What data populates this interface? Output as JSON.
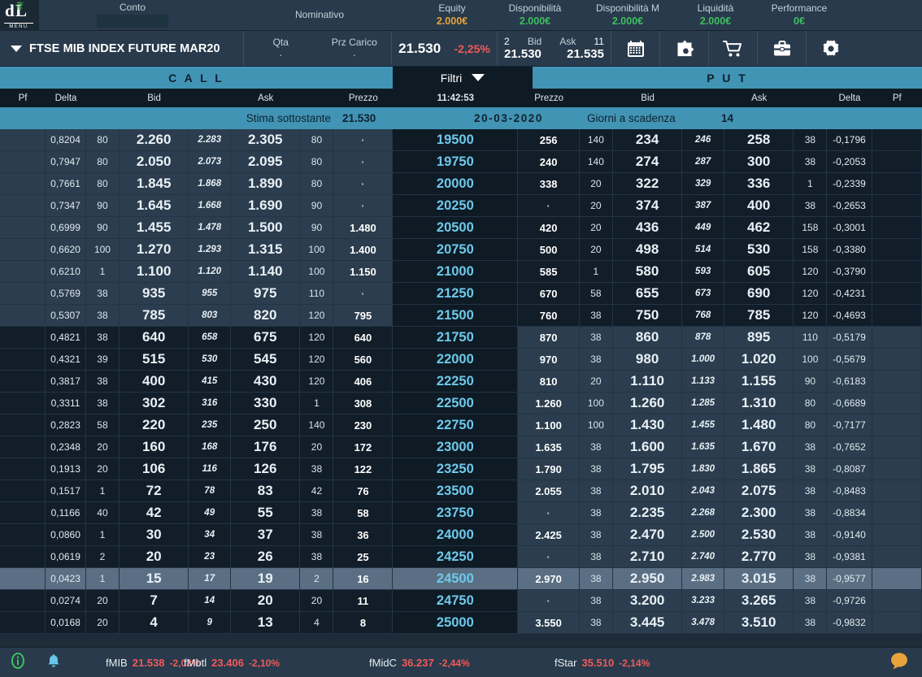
{
  "header": {
    "logo": {
      "d": "d",
      "l": "L",
      "ite": "ite",
      "menu": "MENU"
    },
    "fields": [
      {
        "label": "Conto",
        "value": "",
        "color": ""
      },
      {
        "label": "Nominativo",
        "value": "",
        "color": ""
      },
      {
        "label": "Equity",
        "value": "2.000€",
        "color": "#e8a33d"
      },
      {
        "label": "Disponibilità",
        "value": "2.000€",
        "color": "#3fbf5f"
      },
      {
        "label": "Disponibilità M",
        "value": "2.000€",
        "color": "#3fbf5f"
      },
      {
        "label": "Liquidità",
        "value": "2.000€",
        "color": "#3fbf5f"
      },
      {
        "label": "Performance",
        "value": "0€",
        "color": "#3fbf5f"
      }
    ]
  },
  "instrument": {
    "name": "FTSE MIB INDEX FUTURE MAR20",
    "qta_label": "Qta",
    "qta_value": "·",
    "prz_carico_label": "Prz Carico",
    "prz_carico_value": "·",
    "last_price": "21.530",
    "change_pct": "-2,25%",
    "bid_qty": "2",
    "bid_label": "Bid",
    "ask_label": "Ask",
    "ask_qty": "11",
    "bid_price": "21.530",
    "ask_price": "21.535",
    "tools": [
      "calendar-icon",
      "puzzle-icon",
      "cart-icon",
      "briefcase-icon",
      "gear-icon"
    ]
  },
  "banner": {
    "call": "C A L L",
    "filters": "Filtri",
    "put": "P U T"
  },
  "columns": {
    "call": [
      "Pf",
      "Delta",
      "",
      "Bid",
      "",
      "Ask",
      "",
      "Prezzo"
    ],
    "time": "11:42:53",
    "put": [
      "Prezzo",
      "",
      "Bid",
      "",
      "Ask",
      "",
      "Delta",
      "Pf"
    ]
  },
  "info": {
    "stima_label": "Stima sottostante",
    "stima_value": "21.530",
    "expiry": "20-03-2020",
    "giorni_label": "Giorni a scadenza",
    "giorni_value": "14"
  },
  "chain": [
    {
      "strike": "19500",
      "sel": false,
      "call_itm": true,
      "put_itm": false,
      "c_delta": "0,8204",
      "c_bq": "80",
      "c_bid": "2.260",
      "c_mid": "2.283",
      "c_ask": "2.305",
      "c_aq": "80",
      "c_prz": "·",
      "p_prz": "256",
      "p_bq": "140",
      "p_bid": "234",
      "p_mid": "246",
      "p_ask": "258",
      "p_aq": "38",
      "p_delta": "-0,1796"
    },
    {
      "strike": "19750",
      "sel": false,
      "call_itm": true,
      "put_itm": false,
      "c_delta": "0,7947",
      "c_bq": "80",
      "c_bid": "2.050",
      "c_mid": "2.073",
      "c_ask": "2.095",
      "c_aq": "80",
      "c_prz": "·",
      "p_prz": "240",
      "p_bq": "140",
      "p_bid": "274",
      "p_mid": "287",
      "p_ask": "300",
      "p_aq": "38",
      "p_delta": "-0,2053"
    },
    {
      "strike": "20000",
      "sel": false,
      "call_itm": true,
      "put_itm": false,
      "c_delta": "0,7661",
      "c_bq": "80",
      "c_bid": "1.845",
      "c_mid": "1.868",
      "c_ask": "1.890",
      "c_aq": "80",
      "c_prz": "·",
      "p_prz": "338",
      "p_bq": "20",
      "p_bid": "322",
      "p_mid": "329",
      "p_ask": "336",
      "p_aq": "1",
      "p_delta": "-0,2339"
    },
    {
      "strike": "20250",
      "sel": false,
      "call_itm": true,
      "put_itm": false,
      "c_delta": "0,7347",
      "c_bq": "90",
      "c_bid": "1.645",
      "c_mid": "1.668",
      "c_ask": "1.690",
      "c_aq": "90",
      "c_prz": "·",
      "p_prz": "·",
      "p_bq": "20",
      "p_bid": "374",
      "p_mid": "387",
      "p_ask": "400",
      "p_aq": "38",
      "p_delta": "-0,2653"
    },
    {
      "strike": "20500",
      "sel": false,
      "call_itm": true,
      "put_itm": false,
      "c_delta": "0,6999",
      "c_bq": "90",
      "c_bid": "1.455",
      "c_mid": "1.478",
      "c_ask": "1.500",
      "c_aq": "90",
      "c_prz": "1.480",
      "p_prz": "420",
      "p_bq": "20",
      "p_bid": "436",
      "p_mid": "449",
      "p_ask": "462",
      "p_aq": "158",
      "p_delta": "-0,3001"
    },
    {
      "strike": "20750",
      "sel": false,
      "call_itm": true,
      "put_itm": false,
      "c_delta": "0,6620",
      "c_bq": "100",
      "c_bid": "1.270",
      "c_mid": "1.293",
      "c_ask": "1.315",
      "c_aq": "100",
      "c_prz": "1.400",
      "p_prz": "500",
      "p_bq": "20",
      "p_bid": "498",
      "p_mid": "514",
      "p_ask": "530",
      "p_aq": "158",
      "p_delta": "-0,3380"
    },
    {
      "strike": "21000",
      "sel": false,
      "call_itm": true,
      "put_itm": false,
      "c_delta": "0,6210",
      "c_bq": "1",
      "c_bid": "1.100",
      "c_mid": "1.120",
      "c_ask": "1.140",
      "c_aq": "100",
      "c_prz": "1.150",
      "p_prz": "585",
      "p_bq": "1",
      "p_bid": "580",
      "p_mid": "593",
      "p_ask": "605",
      "p_aq": "120",
      "p_delta": "-0,3790"
    },
    {
      "strike": "21250",
      "sel": false,
      "call_itm": true,
      "put_itm": false,
      "c_delta": "0,5769",
      "c_bq": "38",
      "c_bid": "935",
      "c_mid": "955",
      "c_ask": "975",
      "c_aq": "110",
      "c_prz": "·",
      "p_prz": "670",
      "p_bq": "58",
      "p_bid": "655",
      "p_mid": "673",
      "p_ask": "690",
      "p_aq": "120",
      "p_delta": "-0,4231"
    },
    {
      "strike": "21500",
      "sel": false,
      "call_itm": true,
      "put_itm": false,
      "c_delta": "0,5307",
      "c_bq": "38",
      "c_bid": "785",
      "c_mid": "803",
      "c_ask": "820",
      "c_aq": "120",
      "c_prz": "795",
      "p_prz": "760",
      "p_bq": "38",
      "p_bid": "750",
      "p_mid": "768",
      "p_ask": "785",
      "p_aq": "120",
      "p_delta": "-0,4693"
    },
    {
      "strike": "21750",
      "sel": false,
      "call_itm": false,
      "put_itm": true,
      "c_delta": "0,4821",
      "c_bq": "38",
      "c_bid": "640",
      "c_mid": "658",
      "c_ask": "675",
      "c_aq": "120",
      "c_prz": "640",
      "p_prz": "870",
      "p_bq": "38",
      "p_bid": "860",
      "p_mid": "878",
      "p_ask": "895",
      "p_aq": "110",
      "p_delta": "-0,5179"
    },
    {
      "strike": "22000",
      "sel": false,
      "call_itm": false,
      "put_itm": true,
      "c_delta": "0,4321",
      "c_bq": "39",
      "c_bid": "515",
      "c_mid": "530",
      "c_ask": "545",
      "c_aq": "120",
      "c_prz": "560",
      "p_prz": "970",
      "p_bq": "38",
      "p_bid": "980",
      "p_mid": "1.000",
      "p_ask": "1.020",
      "p_aq": "100",
      "p_delta": "-0,5679"
    },
    {
      "strike": "22250",
      "sel": false,
      "call_itm": false,
      "put_itm": true,
      "c_delta": "0,3817",
      "c_bq": "38",
      "c_bid": "400",
      "c_mid": "415",
      "c_ask": "430",
      "c_aq": "120",
      "c_prz": "406",
      "p_prz": "810",
      "p_bq": "20",
      "p_bid": "1.110",
      "p_mid": "1.133",
      "p_ask": "1.155",
      "p_aq": "90",
      "p_delta": "-0,6183"
    },
    {
      "strike": "22500",
      "sel": false,
      "call_itm": false,
      "put_itm": true,
      "c_delta": "0,3311",
      "c_bq": "38",
      "c_bid": "302",
      "c_mid": "316",
      "c_ask": "330",
      "c_aq": "1",
      "c_prz": "308",
      "p_prz": "1.260",
      "p_bq": "100",
      "p_bid": "1.260",
      "p_mid": "1.285",
      "p_ask": "1.310",
      "p_aq": "80",
      "p_delta": "-0,6689"
    },
    {
      "strike": "22750",
      "sel": false,
      "call_itm": false,
      "put_itm": true,
      "c_delta": "0,2823",
      "c_bq": "58",
      "c_bid": "220",
      "c_mid": "235",
      "c_ask": "250",
      "c_aq": "140",
      "c_prz": "230",
      "p_prz": "1.100",
      "p_bq": "100",
      "p_bid": "1.430",
      "p_mid": "1.455",
      "p_ask": "1.480",
      "p_aq": "80",
      "p_delta": "-0,7177"
    },
    {
      "strike": "23000",
      "sel": false,
      "call_itm": false,
      "put_itm": true,
      "c_delta": "0,2348",
      "c_bq": "20",
      "c_bid": "160",
      "c_mid": "168",
      "c_ask": "176",
      "c_aq": "20",
      "c_prz": "172",
      "p_prz": "1.635",
      "p_bq": "38",
      "p_bid": "1.600",
      "p_mid": "1.635",
      "p_ask": "1.670",
      "p_aq": "38",
      "p_delta": "-0,7652"
    },
    {
      "strike": "23250",
      "sel": false,
      "call_itm": false,
      "put_itm": true,
      "c_delta": "0,1913",
      "c_bq": "20",
      "c_bid": "106",
      "c_mid": "116",
      "c_ask": "126",
      "c_aq": "38",
      "c_prz": "122",
      "p_prz": "1.790",
      "p_bq": "38",
      "p_bid": "1.795",
      "p_mid": "1.830",
      "p_ask": "1.865",
      "p_aq": "38",
      "p_delta": "-0,8087"
    },
    {
      "strike": "23500",
      "sel": false,
      "call_itm": false,
      "put_itm": true,
      "c_delta": "0,1517",
      "c_bq": "1",
      "c_bid": "72",
      "c_mid": "78",
      "c_ask": "83",
      "c_aq": "42",
      "c_prz": "76",
      "p_prz": "2.055",
      "p_bq": "38",
      "p_bid": "2.010",
      "p_mid": "2.043",
      "p_ask": "2.075",
      "p_aq": "38",
      "p_delta": "-0,8483"
    },
    {
      "strike": "23750",
      "sel": false,
      "call_itm": false,
      "put_itm": true,
      "c_delta": "0,1166",
      "c_bq": "40",
      "c_bid": "42",
      "c_mid": "49",
      "c_ask": "55",
      "c_aq": "38",
      "c_prz": "58",
      "p_prz": "·",
      "p_bq": "38",
      "p_bid": "2.235",
      "p_mid": "2.268",
      "p_ask": "2.300",
      "p_aq": "38",
      "p_delta": "-0,8834"
    },
    {
      "strike": "24000",
      "sel": false,
      "call_itm": false,
      "put_itm": true,
      "c_delta": "0,0860",
      "c_bq": "1",
      "c_bid": "30",
      "c_mid": "34",
      "c_ask": "37",
      "c_aq": "38",
      "c_prz": "36",
      "p_prz": "2.425",
      "p_bq": "38",
      "p_bid": "2.470",
      "p_mid": "2.500",
      "p_ask": "2.530",
      "p_aq": "38",
      "p_delta": "-0,9140"
    },
    {
      "strike": "24250",
      "sel": false,
      "call_itm": false,
      "put_itm": true,
      "c_delta": "0,0619",
      "c_bq": "2",
      "c_bid": "20",
      "c_mid": "23",
      "c_ask": "26",
      "c_aq": "38",
      "c_prz": "25",
      "p_prz": "·",
      "p_bq": "38",
      "p_bid": "2.710",
      "p_mid": "2.740",
      "p_ask": "2.770",
      "p_aq": "38",
      "p_delta": "-0,9381"
    },
    {
      "strike": "24500",
      "sel": true,
      "call_itm": false,
      "put_itm": true,
      "c_delta": "0,0423",
      "c_bq": "1",
      "c_bid": "15",
      "c_mid": "17",
      "c_ask": "19",
      "c_aq": "2",
      "c_prz": "16",
      "p_prz": "2.970",
      "p_bq": "38",
      "p_bid": "2.950",
      "p_mid": "2.983",
      "p_ask": "3.015",
      "p_aq": "38",
      "p_delta": "-0,9577"
    },
    {
      "strike": "24750",
      "sel": false,
      "call_itm": false,
      "put_itm": true,
      "c_delta": "0,0274",
      "c_bq": "20",
      "c_bid": "7",
      "c_mid": "14",
      "c_ask": "20",
      "c_aq": "20",
      "c_prz": "11",
      "p_prz": "·",
      "p_bq": "38",
      "p_bid": "3.200",
      "p_mid": "3.233",
      "p_ask": "3.265",
      "p_aq": "38",
      "p_delta": "-0,9726"
    },
    {
      "strike": "25000",
      "sel": false,
      "call_itm": false,
      "put_itm": true,
      "c_delta": "0,0168",
      "c_bq": "20",
      "c_bid": "4",
      "c_mid": "9",
      "c_ask": "13",
      "c_aq": "4",
      "c_prz": "8",
      "p_prz": "3.550",
      "p_bq": "38",
      "p_bid": "3.445",
      "p_mid": "3.478",
      "p_ask": "3.510",
      "p_aq": "38",
      "p_delta": "-0,9832"
    }
  ],
  "footer": {
    "info_icon": "info-icon",
    "bell_icon": "bell-icon",
    "chat_icon": "chat-icon",
    "tickers": [
      {
        "name": "fMIB",
        "value": "21.538",
        "change": "-2,03%"
      },
      {
        "name": "fMbtl",
        "value": "23.406",
        "change": "-2,10%"
      },
      {
        "name": "fMidC",
        "value": "36.237",
        "change": "-2,44%"
      },
      {
        "name": "fStar",
        "value": "35.510",
        "change": "-2,14%"
      }
    ]
  }
}
